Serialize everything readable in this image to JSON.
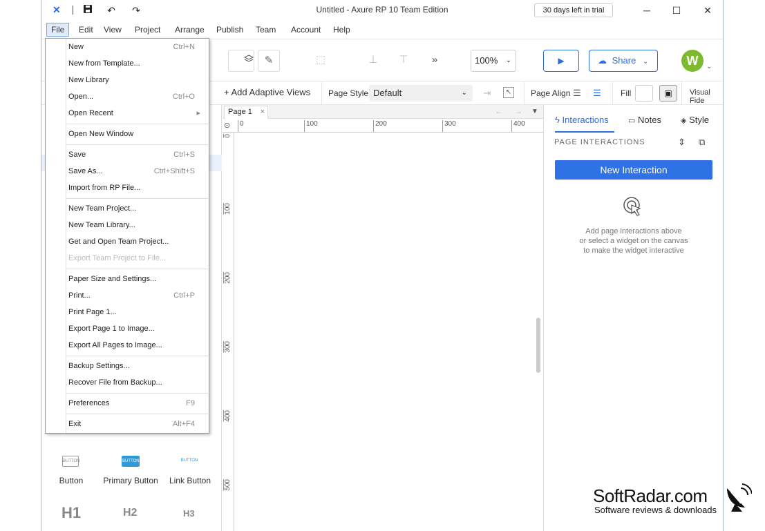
{
  "window": {
    "title": "Untitled - Axure RP 10 Team Edition",
    "trial_badge": "30 days left in trial",
    "minimize": "─",
    "maximize": "☐",
    "close": "✕"
  },
  "menubar": [
    "File",
    "Edit",
    "View",
    "Project",
    "Arrange",
    "Publish",
    "Team",
    "Account",
    "Help"
  ],
  "toolbar": {
    "zoom": "100%",
    "share": "Share",
    "avatar_initial": "W"
  },
  "propbar": {
    "add_adaptive_views": "+ Add Adaptive Views",
    "page_style_label": "Page Style",
    "page_style_value": "Default",
    "page_align_label": "Page Align",
    "fill_label": "Fill",
    "visual_fidelity_label": "Visual Fide"
  },
  "page_tab": "Page 1",
  "ruler": {
    "h_ticks": [
      "0",
      "100",
      "200",
      "300",
      "400"
    ],
    "v_ticks": [
      "0",
      "100",
      "200",
      "300",
      "400",
      "500"
    ]
  },
  "right_panel": {
    "tabs": [
      "Interactions",
      "Notes",
      "Style"
    ],
    "section_title": "PAGE INTERACTIONS",
    "new_interaction": "New Interaction",
    "hint_lines": [
      "Add page interactions above",
      "or select a widget on the canvas",
      "to make the widget interactive"
    ]
  },
  "file_menu": [
    {
      "label": "New",
      "shortcut": "Ctrl+N"
    },
    {
      "label": "New from Template...",
      "shortcut": ""
    },
    {
      "label": "New Library",
      "shortcut": ""
    },
    {
      "label": "Open...",
      "shortcut": "Ctrl+O"
    },
    {
      "label": "Open Recent",
      "shortcut": "▸"
    },
    {
      "label": "Open New Window",
      "shortcut": ""
    },
    {
      "label": "Save",
      "shortcut": "Ctrl+S"
    },
    {
      "label": "Save As...",
      "shortcut": "Ctrl+Shift+S"
    },
    {
      "label": "Import from RP File...",
      "shortcut": ""
    },
    {
      "label": "New Team Project...",
      "shortcut": ""
    },
    {
      "label": "New Team Library...",
      "shortcut": ""
    },
    {
      "label": "Get and Open Team Project...",
      "shortcut": ""
    },
    {
      "label": "Export Team Project to File...",
      "shortcut": ""
    },
    {
      "label": "Paper Size and Settings...",
      "shortcut": ""
    },
    {
      "label": "Print...",
      "shortcut": "Ctrl+P"
    },
    {
      "label": "Print Page 1...",
      "shortcut": ""
    },
    {
      "label": "Export Page 1 to Image...",
      "shortcut": ""
    },
    {
      "label": "Export All Pages to Image...",
      "shortcut": ""
    },
    {
      "label": "Backup Settings...",
      "shortcut": ""
    },
    {
      "label": "Recover File from Backup...",
      "shortcut": ""
    },
    {
      "label": "Preferences",
      "shortcut": "F9"
    },
    {
      "label": "Exit",
      "shortcut": "Alt+F4"
    }
  ],
  "library": {
    "widgets": [
      "Button",
      "Primary Button",
      "Link Button"
    ],
    "icon_text": "BUTTON",
    "headings": [
      "H1",
      "H2",
      "H3"
    ]
  },
  "watermark": {
    "title": "SoftRadar.com",
    "subtitle": "Software reviews & downloads"
  },
  "colors": {
    "accent": "#2e72e6",
    "avatar": "#7dba2f"
  }
}
